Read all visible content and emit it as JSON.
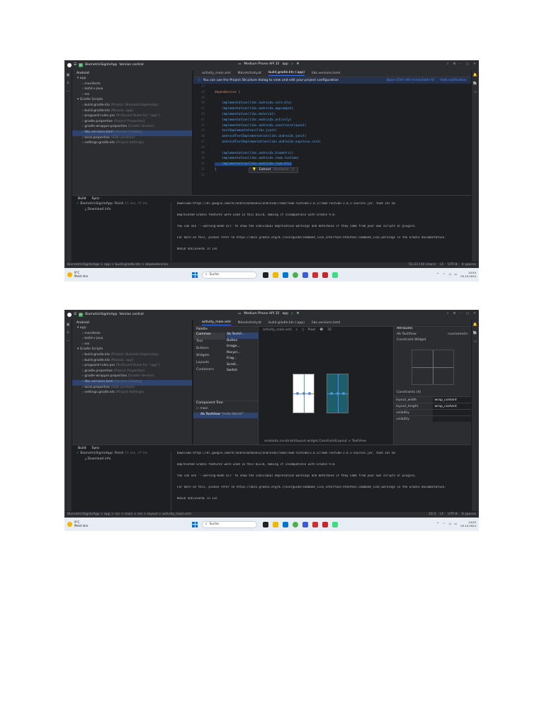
{
  "shot1": {
    "titlebar": {
      "project": "BiometricSignInApp",
      "vcs": "Version control",
      "device": "Medium Phone API 35",
      "run_config": "app"
    },
    "project_panel": {
      "view": "Android",
      "tree": [
        {
          "label": "app",
          "hint": "",
          "indent": 1
        },
        {
          "label": "manifests",
          "hint": "",
          "indent": 2
        },
        {
          "label": "kotlin+java",
          "hint": "",
          "indent": 2
        },
        {
          "label": "res",
          "hint": "",
          "indent": 2
        },
        {
          "label": "Gradle Scripts",
          "hint": "",
          "indent": 1
        },
        {
          "label": "build.gradle.kts",
          "hint": "(Project: BiometricSignInApp)",
          "indent": 2
        },
        {
          "label": "build.gradle.kts",
          "hint": "(Module :app)",
          "indent": 2
        },
        {
          "label": "proguard-rules.pro",
          "hint": "(ProGuard Rules for \":app\")",
          "indent": 2
        },
        {
          "label": "gradle.properties",
          "hint": "(Project Properties)",
          "indent": 2
        },
        {
          "label": "gradle-wrapper.properties",
          "hint": "(Gradle Version)",
          "indent": 2
        },
        {
          "label": "libs.versions.toml",
          "hint": "(Version Catalog)",
          "indent": 2
        },
        {
          "label": "local.properties",
          "hint": "(SDK Location)",
          "indent": 2
        },
        {
          "label": "settings.gradle.kts",
          "hint": "(Project Settings)",
          "indent": 2
        }
      ],
      "selected_index": 10
    },
    "tabs": [
      "activity_main.xml",
      "MainActivity.kt",
      "build.gradle.kts (:app)",
      "libs.versions.toml"
    ],
    "active_tab": 2,
    "notice": {
      "text": "You can use the Project Structure dialog to view and edit your project configuration",
      "open_link": "Open (Ctrl+Alt+Umschalt+S)",
      "hide_link": "Hide notification"
    },
    "code": [
      {
        "n": "37",
        "t": ""
      },
      {
        "n": "38",
        "t": "dependencies {"
      },
      {
        "n": "39",
        "t": ""
      },
      {
        "n": "40",
        "t": "    implementation(libs.androidx.core.ktx)"
      },
      {
        "n": "41",
        "t": "    implementation(libs.androidx.appcompat)"
      },
      {
        "n": "42",
        "t": "    implementation(libs.material)"
      },
      {
        "n": "43",
        "t": "    implementation(libs.androidx.activity)"
      },
      {
        "n": "44",
        "t": "    implementation(libs.androidx.constraintlayout)"
      },
      {
        "n": "45",
        "t": "    testImplementation(libs.junit)"
      },
      {
        "n": "46",
        "t": "    androidTestImplementation(libs.androidx.junit)"
      },
      {
        "n": "47",
        "t": "    androidTestImplementation(libs.androidx.espresso.core)"
      },
      {
        "n": "48",
        "t": ""
      },
      {
        "n": "49",
        "t": "    implementation(libs.androidx.biometric)"
      },
      {
        "n": "50",
        "t": "    implementation(libs.androidx.room.runtime)"
      },
      {
        "n": "51",
        "t": "    implementation(libs.androidx.room.ktx)"
      },
      {
        "n": "52",
        "t": "}"
      },
      {
        "n": "53",
        "t": ""
      }
    ],
    "popup": {
      "action1": "Extract",
      "action2": "Surround"
    },
    "build": {
      "tab1": "Build",
      "tab2": "Sync",
      "tree_root": "BiometricSignInApp: Finish",
      "tree_time": "11 sec, 37 ms",
      "tree_child": "Download info",
      "output": [
        "Download https://dl.google.com/dl/android/maven2/androidx/room/room-runtime/2.6.1/room-runtime-2.6.1-sources.jar, took 147 ms",
        "Deprecated Gradle features were used in this build, making it incompatible with Gradle 9.0.",
        "You can use '--warning-mode all' to show the individual deprecation warnings and determine if they come from your own scripts or plugins.",
        "For more on this, please refer to https://docs.gradle.org/8.7/userguide/command_line_interface.html#sec:command_line_warnings in the Gradle documentation.",
        "BUILD SUCCESSFUL in 13s"
      ]
    },
    "statusbar": {
      "path": "BiometricSignInApp > app > build.gradle.kts > dependencies",
      "position": "51:23 (34 chars)",
      "line_sep": "LF",
      "encoding": "UTF-8",
      "indent": "4 spaces"
    },
    "taskbar": {
      "temp": "9°C",
      "weather": "Meist klar",
      "search": "Suche",
      "time": "14:54",
      "date": "03.10.2024"
    }
  },
  "shot2": {
    "titlebar": {
      "project": "BiometricSignInApp",
      "vcs": "Version control",
      "device": "Medium Phone API 35",
      "run_config": "app"
    },
    "project_panel": {
      "view": "Android",
      "tree": [
        {
          "label": "app",
          "hint": "",
          "indent": 1
        },
        {
          "label": "manifests",
          "hint": "",
          "indent": 2
        },
        {
          "label": "kotlin+java",
          "hint": "",
          "indent": 2
        },
        {
          "label": "res",
          "hint": "",
          "indent": 2
        },
        {
          "label": "Gradle Scripts",
          "hint": "",
          "indent": 1
        },
        {
          "label": "build.gradle.kts",
          "hint": "(Project: BiometricSignInApp)",
          "indent": 2
        },
        {
          "label": "build.gradle.kts",
          "hint": "(Module :app)",
          "indent": 2
        },
        {
          "label": "proguard-rules.pro",
          "hint": "(ProGuard Rules for \":app\")",
          "indent": 2
        },
        {
          "label": "gradle.properties",
          "hint": "(Project Properties)",
          "indent": 2
        },
        {
          "label": "gradle-wrapper.properties",
          "hint": "(Gradle Version)",
          "indent": 2
        },
        {
          "label": "libs.versions.toml",
          "hint": "(Version Catalog)",
          "indent": 2
        },
        {
          "label": "local.properties",
          "hint": "(SDK Location)",
          "indent": 2
        },
        {
          "label": "settings.gradle.kts",
          "hint": "(Project Settings)",
          "indent": 2
        }
      ],
      "selected_index": 10
    },
    "tabs": [
      "activity_main.xml",
      "MainActivity.kt",
      "build.gradle.kts (:app)",
      "libs.versions.toml"
    ],
    "active_tab": 0,
    "palette": {
      "title": "Palette",
      "categories": [
        "Common",
        "Text",
        "Buttons",
        "Widgets",
        "Layouts",
        "Containers"
      ],
      "items": [
        "Ab TextVi...",
        "Button",
        "Image...",
        "Recycl...",
        "Frag...",
        "Scroll...",
        "Switch"
      ]
    },
    "component_tree": {
      "title": "Component Tree",
      "root": "main",
      "child": "Ab TextView",
      "child_hint": "\"Hello World!\""
    },
    "canvas": {
      "file": "activity_main.xml",
      "mode": "Pixel",
      "api": "35",
      "path": "androidx.constraintlayout.widget.ConstraintLayout > TextView"
    },
    "attributes": {
      "title": "Attributes",
      "widget": "Ab TextView",
      "id": "<unnamed>",
      "section": "Constraint Widget",
      "constraints": "Constraints (4)",
      "props": [
        {
          "k": "layout_width",
          "v": "wrap_content"
        },
        {
          "k": "layout_height",
          "v": "wrap_content"
        },
        {
          "k": "visibility",
          "v": ""
        },
        {
          "k": "visibility",
          "v": ""
        }
      ]
    },
    "build": {
      "tab1": "Build",
      "tab2": "Sync",
      "tree_root": "BiometricSignInApp: Finish",
      "tree_time": "11 sec, 37 ms",
      "tree_child": "Download info",
      "output": [
        "Download https://dl.google.com/dl/android/maven2/androidx/room/room-runtime/2.6.1/room-runtime-2.6.1-sources.jar, took 147 ms",
        "Deprecated Gradle features were used in this build, making it incompatible with Gradle 9.0.",
        "You can use '--warning-mode all' to show the individual deprecation warnings and determine if they come from your own scripts or plugins.",
        "For more on this, please refer to https://docs.gradle.org/8.7/userguide/command_line_interface.html#sec:command_line_warnings in the Gradle documentation.",
        "BUILD SUCCESSFUL in 13s"
      ]
    },
    "statusbar": {
      "path": "BiometricSignInApp > app > src > main > res > layout > activity_main.xml",
      "position": "10:3",
      "line_sep": "LF",
      "encoding": "UTF-8",
      "indent": "4 spaces"
    },
    "taskbar": {
      "temp": "9°C",
      "weather": "Meist klar",
      "search": "Suche",
      "time": "14:55",
      "date": "03.10.2024"
    }
  },
  "colors": {
    "ide_bg": "#1e1f22",
    "panel_bg": "#2b2d30",
    "accent": "#3574f0",
    "selection": "#2e436e",
    "success": "#5fb865",
    "link": "#548af7"
  }
}
